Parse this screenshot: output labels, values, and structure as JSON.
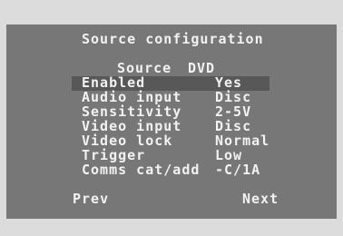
{
  "osd": {
    "title": "Source configuration",
    "source_label": "Source",
    "source_value": "DVD",
    "rows": [
      {
        "label": "Enabled",
        "value": "Yes",
        "selected": true
      },
      {
        "label": "Audio input",
        "value": "Disc"
      },
      {
        "label": "Sensitivity",
        "value": "2-5V"
      },
      {
        "label": "Video input",
        "value": "Disc"
      },
      {
        "label": "Video lock",
        "value": "Normal"
      },
      {
        "label": "Trigger",
        "value": "Low"
      },
      {
        "label": "Comms cat/add",
        "value": "-C/1A"
      }
    ],
    "prev_label": "Prev",
    "next_label": "Next"
  },
  "colors": {
    "panel": "#777777",
    "highlight": "#585858",
    "text": "#f2f2f2",
    "surround": "#dcdcdc"
  }
}
